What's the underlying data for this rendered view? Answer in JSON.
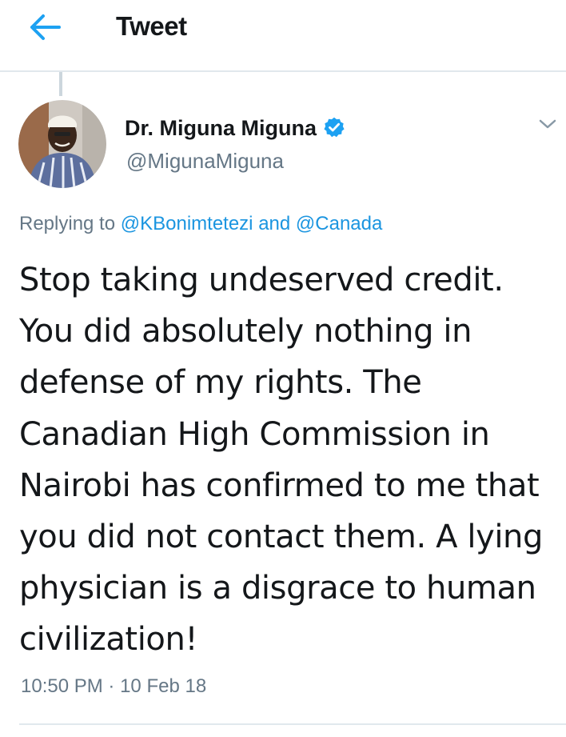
{
  "header": {
    "title": "Tweet",
    "back_icon": "arrow-left-icon"
  },
  "tweet": {
    "author": {
      "display_name": "Dr. Miguna Miguna",
      "handle": "@MigunaMiguna",
      "verified": true
    },
    "reply": {
      "prefix": "Replying to",
      "first_mention": "@KBonimtetezi",
      "conjunction": "and",
      "second_mention": "@Canada"
    },
    "text_lines": [
      "Stop taking undeserved credit.",
      "You did absolutely nothing in",
      "defense of my rights. The",
      "Canadian High Commission in",
      "Nairobi has confirmed to me that",
      "you did not contact them. A lying",
      "physician is a disgrace to human",
      "civilization!"
    ],
    "time": "10:50 PM",
    "separator": "·",
    "date": "10 Feb 18"
  },
  "colors": {
    "accent": "#1da1f2",
    "link": "#1b95e0",
    "secondary_text": "#657786",
    "divider": "#e1e8ed"
  }
}
